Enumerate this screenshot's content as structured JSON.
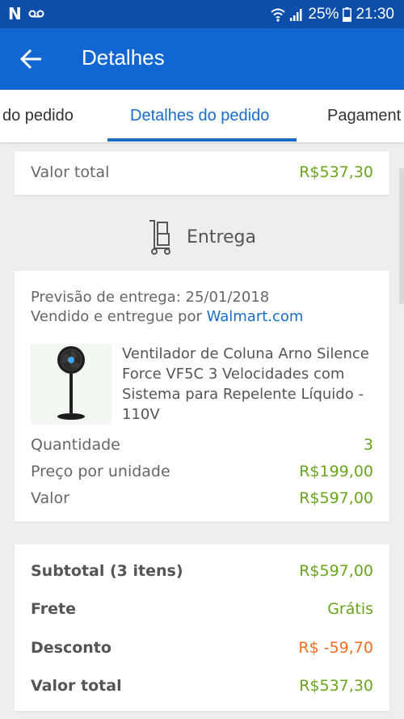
{
  "status_bar": {
    "battery": "25%",
    "time": "21:30"
  },
  "app_bar": {
    "title": "Detalhes"
  },
  "tabs": [
    {
      "label": "do pedido"
    },
    {
      "label": "Detalhes do pedido"
    },
    {
      "label": "Pagament"
    }
  ],
  "top_total": {
    "label": "Valor total",
    "value": "R$537,30"
  },
  "delivery": {
    "section_title": "Entrega",
    "forecast": "Previsão de entrega: 25/01/2018",
    "sold_by_prefix": "Vendido e entregue por ",
    "seller": "Walmart.com",
    "product": {
      "name": "Ventilador de Coluna Arno Silence Force VF5C 3 Velocidades com Sistema para Repelente Líquido - 110V",
      "quantity_label": "Quantidade",
      "quantity": "3",
      "unit_price_label": "Preço por unidade",
      "unit_price": "R$199,00",
      "value_label": "Valor",
      "value": "R$597,00"
    }
  },
  "summary": {
    "subtotal_label": "Subtotal (3 itens)",
    "subtotal": "R$597,00",
    "shipping_label": "Frete",
    "shipping": "Grátis",
    "discount_label": "Desconto",
    "discount": "R$ -59,70",
    "total_label": "Valor total",
    "total": "R$537,30"
  },
  "colors": {
    "status_bar": "#0d4fa8",
    "app_bar": "#1266d2",
    "accent_blue": "#1a6cc9",
    "price_green": "#6aa51c",
    "discount_orange": "#f26f21"
  }
}
